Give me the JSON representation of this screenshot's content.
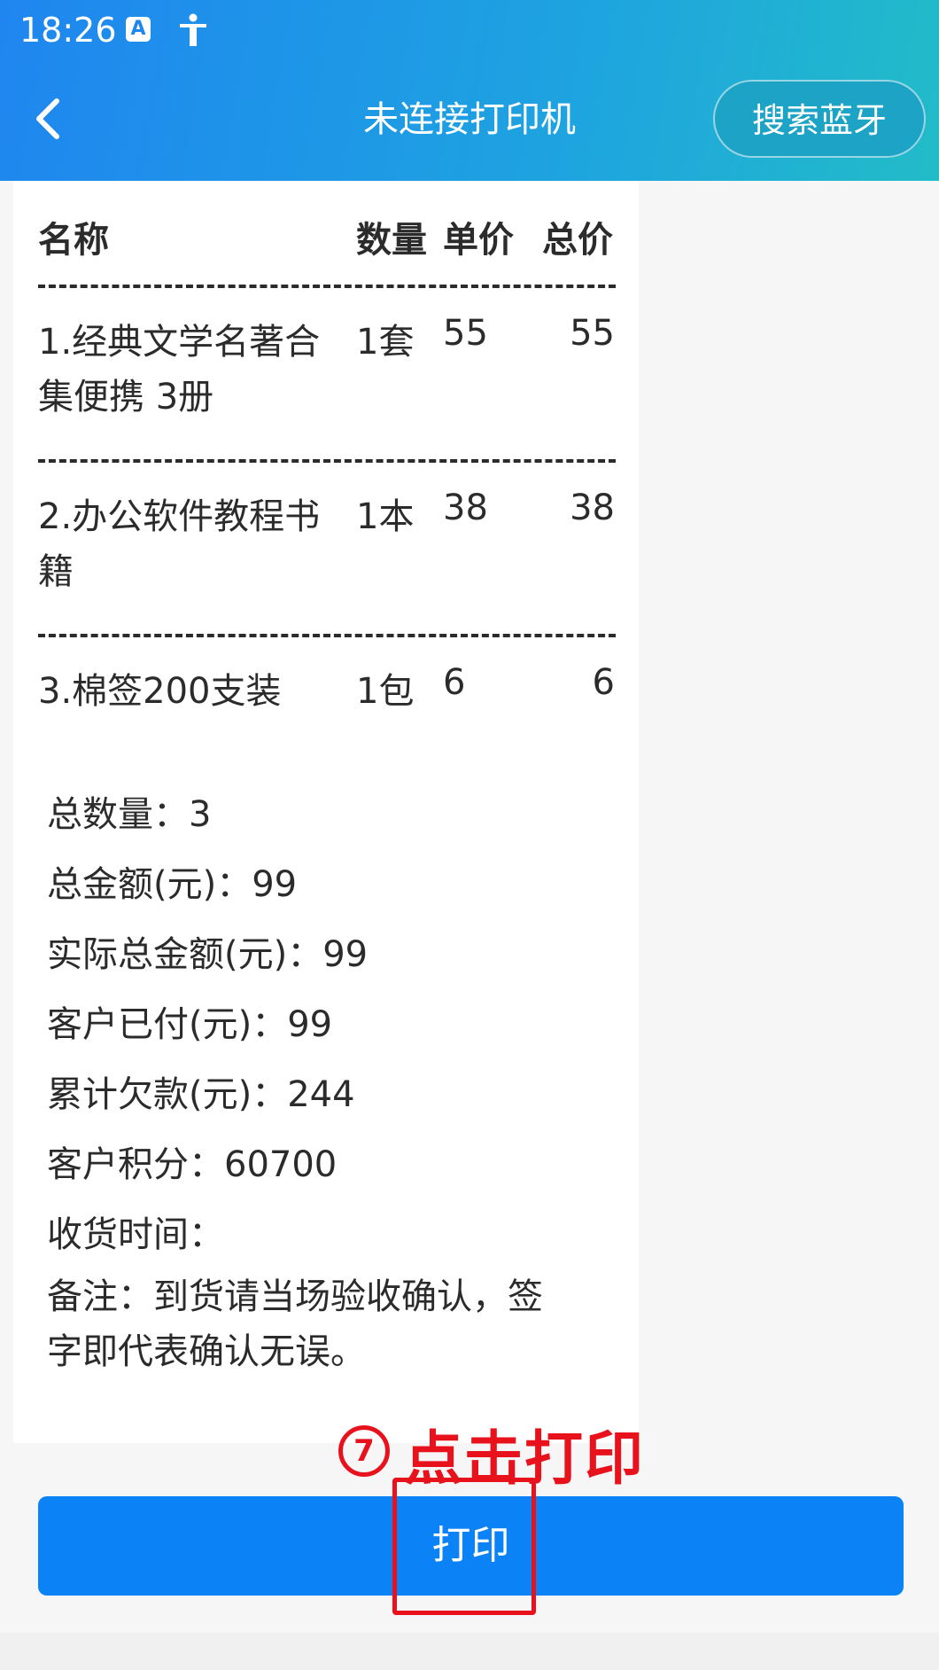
{
  "status_bar": {
    "time": "18:26",
    "a_icon": "A"
  },
  "header": {
    "title": "未连接打印机",
    "search_button": "搜索蓝牙"
  },
  "table": {
    "headers": {
      "name": "名称",
      "qty": "数量",
      "unit": "单价",
      "total": "总价"
    },
    "rows": [
      {
        "name_line1": "1.经典文学名著合",
        "name_line2": "集便携 3册",
        "qty": "1套",
        "unit": "55",
        "total": "55"
      },
      {
        "name_line1": "2.办公软件教程书",
        "name_line2": "籍",
        "qty": "1本",
        "unit": "38",
        "total": "38"
      },
      {
        "name_line1": "3.棉签200支装",
        "name_line2": "",
        "qty": "1包",
        "unit": "6",
        "total": "6"
      }
    ]
  },
  "summary": [
    "总数量：3",
    "总金额(元)：99",
    "实际总金额(元)：99",
    "客户已付(元)：99",
    "累计欠款(元)：244",
    "客户积分：60700",
    "收货时间："
  ],
  "note": {
    "line1": "备注：到货请当场验收确认，签",
    "line2": "字即代表确认无误。"
  },
  "annotation": {
    "number": "7",
    "text": "点击打印"
  },
  "print_button": "打印",
  "colors": {
    "header_start": "#1f86f0",
    "header_end": "#22bcc8",
    "button": "#0b83f7",
    "annotation": "#e8121d"
  }
}
